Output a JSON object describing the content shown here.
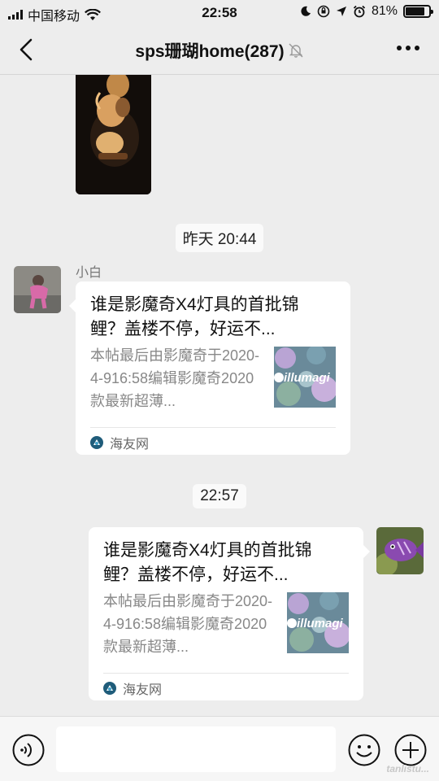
{
  "status_bar": {
    "carrier": "中国移动",
    "time": "22:58",
    "battery": "81%",
    "battery_level": 0.81
  },
  "header": {
    "title": "sps珊瑚home(287)",
    "icons": [
      "back-chevron-icon",
      "mute-bell-icon",
      "more-icon"
    ]
  },
  "messages": {
    "timestamp_1": "昨天 20:44",
    "timestamp_2": "22:57",
    "incoming": {
      "sender": "小白",
      "title": "谁是影魔奇X4灯具的首批锦鲤？盖楼不停，好运不...",
      "description": "本帖最后由影魔奇于2020-4-916:58编辑影魔奇2020款最新超薄...",
      "thumb_text": "illumagi",
      "source": "海友网"
    },
    "outgoing": {
      "title": "谁是影魔奇X4灯具的首批锦鲤？盖楼不停，好运不...",
      "description": "本帖最后由影魔奇于2020-4-916:58编辑影魔奇2020款最新超薄...",
      "thumb_text": "illumagi",
      "source": "海友网"
    }
  },
  "input_bar": {
    "icons": [
      "voice-icon",
      "emoji-icon",
      "add-icon"
    ],
    "watermark": "tanlistu..."
  },
  "colors": {
    "background": "#ededed",
    "bubble": "#ffffff",
    "text": "#111111",
    "secondary_text": "#888888"
  }
}
